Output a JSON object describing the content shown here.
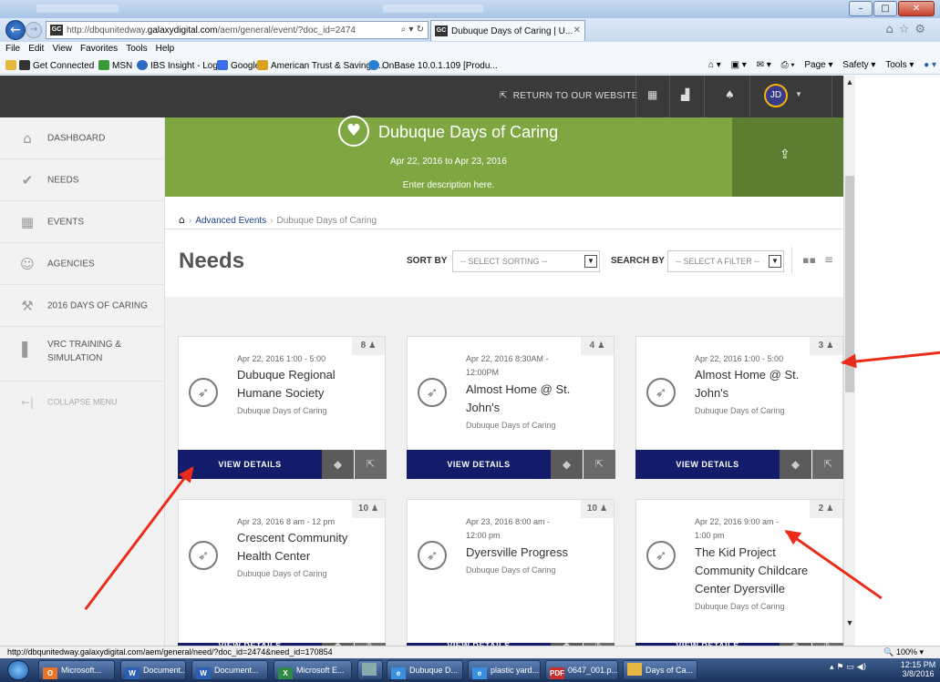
{
  "browser": {
    "address": "http://dbqunitedway.",
    "address_domain": "galaxydigital.com",
    "address_path": "/aem/general/event/?doc_id=2474",
    "address_tools": "⌕ ▾ ↻",
    "tab_title": "Dubuque Days of Caring | U...",
    "menu": [
      "File",
      "Edit",
      "View",
      "Favorites",
      "Tools",
      "Help"
    ],
    "favorites": [
      "Get Connected",
      "MSN",
      "IBS Insight - Log In",
      "Google",
      "American Trust & Savings...",
      "OnBase 10.0.1.109 [Produ..."
    ],
    "commands": [
      "Page ▾",
      "Safety ▾",
      "Tools ▾"
    ],
    "status_url": "http://dbqunitedway.galaxydigital.com/aem/general/need/?doc_id=2474&need_id=170854",
    "zoom": "100%"
  },
  "topnav": {
    "return_label": "RETURN TO OUR WEBSITE",
    "avatar_initials": "JD"
  },
  "sidebar": {
    "items": [
      {
        "label": "DASHBOARD",
        "icon": "home-icon"
      },
      {
        "label": "NEEDS",
        "icon": "check-circle-icon"
      },
      {
        "label": "EVENTS",
        "icon": "calendar-icon"
      },
      {
        "label": "AGENCIES",
        "icon": "agencies-icon"
      },
      {
        "label": "2016 DAYS OF CARING",
        "icon": "hammer-icon"
      },
      {
        "label": "VRC TRAINING & SIMULATION",
        "icon": "training-icon"
      },
      {
        "label": "COLLAPSE MENU",
        "icon": "collapse-arrow-icon"
      }
    ]
  },
  "banner": {
    "title": "Dubuque Days of Caring",
    "dates": "Apr 22, 2016 to Apr 23, 2016",
    "description": "Enter description here."
  },
  "breadcrumb": {
    "link": "Advanced Events",
    "current": "Dubuque Days of Caring"
  },
  "main": {
    "title": "Needs",
    "sort_label": "SORT BY",
    "sort_placeholder": "-- SELECT SORTING --",
    "search_label": "SEARCH BY",
    "search_placeholder": "-- SELECT A FILTER --"
  },
  "cards": [
    {
      "count": "8",
      "date1": "Apr 22, 2016 1:00 - 5:00",
      "date2": "",
      "title1": "Dubuque Regional",
      "title2": "Humane Society",
      "title3": "",
      "title4": "",
      "event": "Dubuque Days of Caring",
      "button": "VIEW DETAILS"
    },
    {
      "count": "4",
      "date1": "Apr 22, 2016 8:30AM -",
      "date2": "12:00PM",
      "title1": "Almost Home @ St.",
      "title2": "John's",
      "title3": "",
      "title4": "",
      "event": "Dubuque Days of Caring",
      "button": "VIEW DETAILS"
    },
    {
      "count": "3",
      "date1": "Apr 22, 2016 1:00 - 5:00",
      "date2": "",
      "title1": "Almost Home @ St.",
      "title2": "John's",
      "title3": "",
      "title4": "",
      "event": "Dubuque Days of Caring",
      "button": "VIEW DETAILS"
    },
    {
      "count": "10",
      "date1": "Apr 23, 2016 8 am - 12 pm",
      "date2": "",
      "title1": "Crescent Community",
      "title2": "Health Center",
      "title3": "",
      "title4": "",
      "event": "Dubuque Days of Caring",
      "button": "VIEW DETAILS"
    },
    {
      "count": "10",
      "date1": "Apr 23, 2016 8:00 am -",
      "date2": "12:00 pm",
      "title1": "Dyersville Progress",
      "title2": "",
      "title3": "",
      "title4": "",
      "event": "Dubuque Days of Caring",
      "button": "VIEW DETAILS"
    },
    {
      "count": "2",
      "date1": "Apr 22, 2016 9:00 am -",
      "date2": "1:00 pm",
      "title1": "The Kid Project",
      "title2": "Community Childcare",
      "title3": "Center Dyersville",
      "title4": "",
      "event": "Dubuque Days of Caring",
      "button": "VIEW DETAILS"
    }
  ],
  "taskbar": {
    "items": [
      "Microsoft...",
      "Document...",
      "Document...",
      "Microsoft E...",
      "",
      "Dubuque D...",
      "plastic yard...",
      "0647_001.p...",
      "Days of Ca..."
    ],
    "time": "12:15 PM",
    "date": "3/8/2016"
  },
  "colors": {
    "banner_green": "#7ea741",
    "banner_dark_green": "#5d7e31",
    "button_navy": "#131b6b",
    "topbar": "#3a3a3a",
    "annotation_arrow": "#ea2d1b",
    "avatar_ring": "#f2b705"
  }
}
